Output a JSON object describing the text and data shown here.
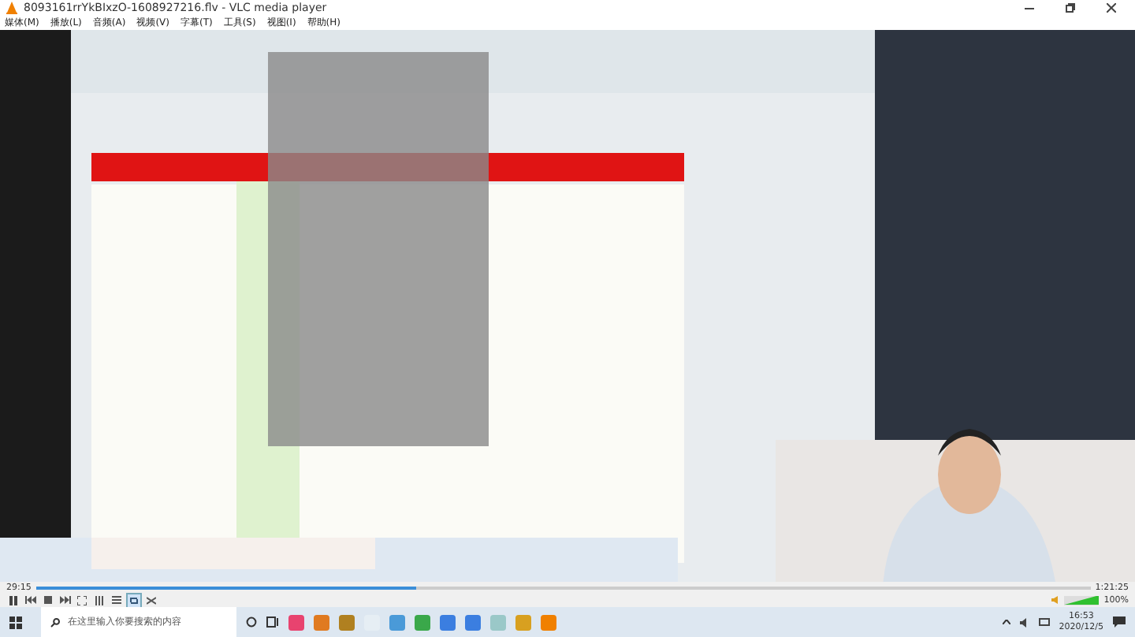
{
  "window": {
    "title": "8093161rrYkBIxzO-1608927216.flv - VLC media player"
  },
  "menu": [
    "媒体(M)",
    "播放(L)",
    "音频(A)",
    "视频(V)",
    "字幕(T)",
    "工具(S)",
    "视图(I)",
    "帮助(H)"
  ],
  "player": {
    "elapsed": "29:15",
    "duration": "1:21:25",
    "progress": {
      "level": 0.36
    },
    "loop": {
      "on": true
    },
    "volume": {
      "level": 1.0,
      "reading": "100%"
    }
  },
  "taskbar": {
    "search": {
      "placeholder": "在这里输入你要搜索的内容"
    },
    "clock": {
      "time": "16:53",
      "date": "2020/12/5"
    }
  }
}
